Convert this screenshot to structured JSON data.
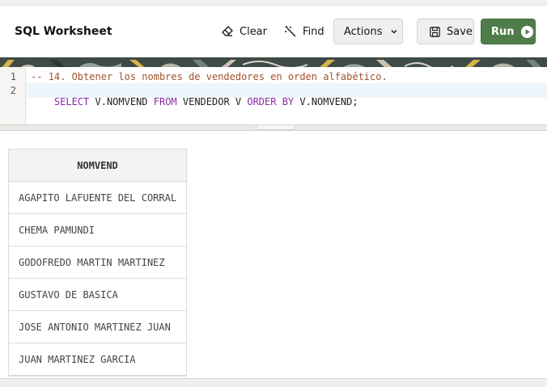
{
  "header": {
    "title": "SQL Worksheet",
    "clear_label": "Clear",
    "find_label": "Find",
    "actions_label": "Actions",
    "save_label": "Save",
    "run_label": "Run"
  },
  "colors": {
    "run_button": "#4f7d4a",
    "comment": "#a0522d",
    "keyword": "#8a2ba8"
  },
  "icons": {
    "clear": "eraser-icon",
    "find": "magic-wand-icon",
    "actions": "chevron-down-icon",
    "save": "floppy-disk-icon",
    "run": "play-circle-icon"
  },
  "editor": {
    "line_numbers": [
      "1",
      "2"
    ],
    "line1": "-- 14. Obtener los nombres de vendedores en orden alfabético.",
    "line2_tokens": [
      {
        "text": "SELECT",
        "kw": true
      },
      {
        "text": " V.NOMVEND ",
        "kw": false
      },
      {
        "text": "FROM",
        "kw": true
      },
      {
        "text": " VENDEDOR V ",
        "kw": false
      },
      {
        "text": "ORDER BY",
        "kw": true
      },
      {
        "text": " V.NOMVEND;",
        "kw": false
      }
    ]
  },
  "results": {
    "columns": [
      "NOMVEND"
    ],
    "rows": [
      "AGAPITO LAFUENTE DEL CORRAL",
      "CHEMA PAMUNDI",
      "GODOFREDO MARTIN MARTINEZ",
      "GUSTAVO DE BASICA",
      "JOSE ANTONIO MARTINEZ JUAN",
      "JUAN MARTINEZ GARCIA"
    ]
  }
}
